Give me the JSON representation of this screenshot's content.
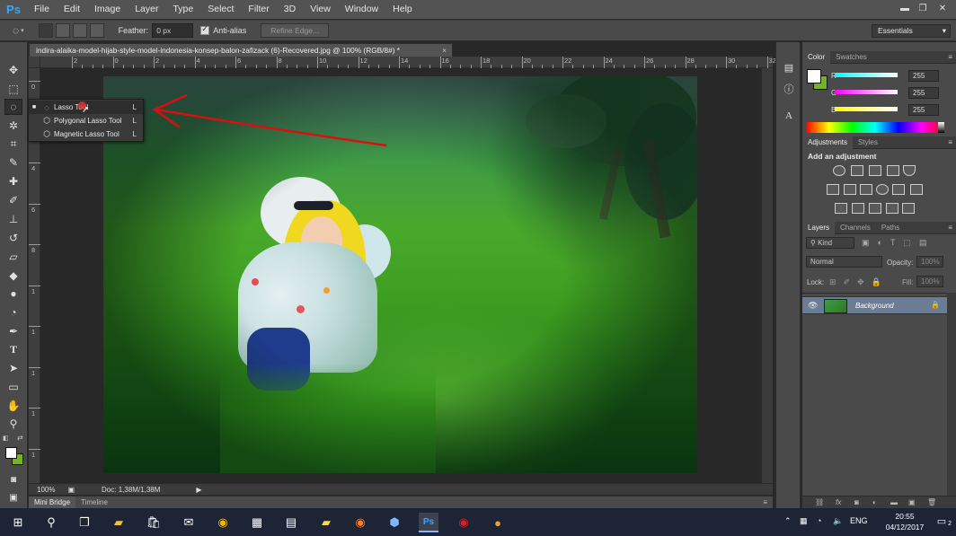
{
  "app": {
    "logo": "Ps"
  },
  "menu": [
    "File",
    "Edit",
    "Image",
    "Layer",
    "Type",
    "Select",
    "Filter",
    "3D",
    "View",
    "Window",
    "Help"
  ],
  "window_controls": {
    "minimize": "▬",
    "restore": "❐",
    "close": "✕"
  },
  "options": {
    "feather_label": "Feather:",
    "feather_value": "0 px",
    "antialias_label": "Anti-alias",
    "antialias_checked": true,
    "refine_edge": "Refine Edge...",
    "workspace": "Essentials"
  },
  "document": {
    "tab_title": "indira-alaika-model-hijab-style-model-indonesia-konsep-balon-zafizack (6)-Recovered.jpg @ 100% (RGB/8#) *",
    "close": "×",
    "ruler_top": [
      "2",
      "0",
      "2",
      "4",
      "6",
      "8",
      "10",
      "12",
      "14",
      "16",
      "18",
      "20",
      "22",
      "24",
      "26",
      "28",
      "30",
      "32"
    ],
    "ruler_left": [
      "0",
      "2",
      "4",
      "6",
      "8",
      "1",
      "1",
      "1",
      "1",
      "1",
      "2",
      "2"
    ],
    "zoom": "100%",
    "doc_info": "Doc: 1,38M/1,38M"
  },
  "lasso_menu": [
    {
      "label": "Lasso Tool",
      "key": "L",
      "selected": true
    },
    {
      "label": "Polygonal Lasso Tool",
      "key": "L",
      "selected": false
    },
    {
      "label": "Magnetic Lasso Tool",
      "key": "L",
      "selected": false
    }
  ],
  "bottom_tabs": [
    "Mini Bridge",
    "Timeline"
  ],
  "color_panel": {
    "tabs": [
      "Color",
      "Swatches"
    ],
    "channels": [
      {
        "label": "R",
        "value": "255"
      },
      {
        "label": "G",
        "value": "255"
      },
      {
        "label": "B",
        "value": "255"
      }
    ],
    "foreground": "#ffffff",
    "background": "#74b228"
  },
  "adjustments_panel": {
    "tabs": [
      "Adjustments",
      "Styles"
    ],
    "heading": "Add an adjustment"
  },
  "layers_panel": {
    "tabs": [
      "Layers",
      "Channels",
      "Paths"
    ],
    "filter_kind": "Kind",
    "blend_mode": "Normal",
    "opacity_label": "Opacity:",
    "opacity_value": "100%",
    "lock_label": "Lock:",
    "fill_label": "Fill:",
    "fill_value": "100%",
    "layer_name": "Background"
  },
  "taskbar": {
    "time": "20:55",
    "date": "04/12/2017",
    "language": "ENG",
    "notifications": "2"
  }
}
